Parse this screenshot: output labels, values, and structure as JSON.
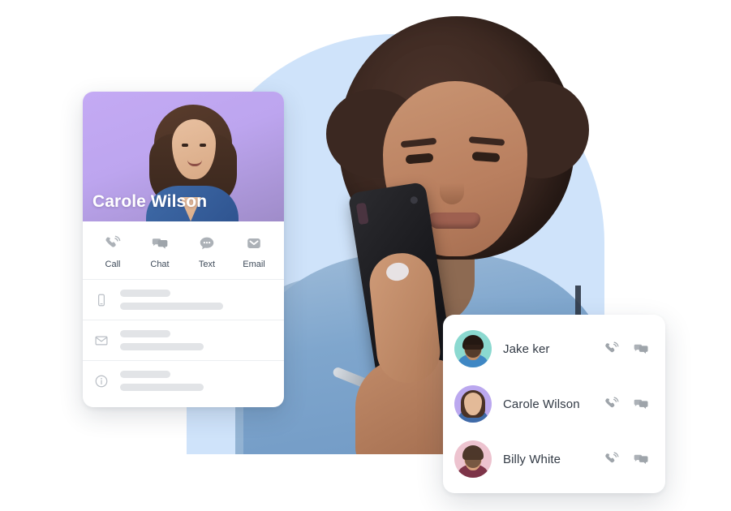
{
  "scene": {
    "backdrop_color": "#cfe3fa",
    "page_background": "#ffffff"
  },
  "hero_photo": {
    "alt": "Nurse in blue scrubs with stethoscope looking at a smartphone",
    "name": "hero-nurse-photo"
  },
  "contact_card": {
    "person_name": "Carole Wilson",
    "header_gradient": [
      "#c4aaf4",
      "#9f8cc9"
    ],
    "actions": [
      {
        "icon": "call-icon",
        "label": "Call"
      },
      {
        "icon": "chat-icon",
        "label": "Chat"
      },
      {
        "icon": "text-icon",
        "label": "Text"
      },
      {
        "icon": "email-icon",
        "label": "Email"
      }
    ],
    "detail_rows": [
      {
        "icon": "mobile-icon",
        "placeholder": true
      },
      {
        "icon": "envelope-icon",
        "placeholder": true
      },
      {
        "icon": "info-icon",
        "placeholder": true
      }
    ]
  },
  "contact_list": {
    "items": [
      {
        "name": "Jake ker",
        "avatar_bg": "#8bd9d0",
        "call_icon": "call-icon",
        "chat_icon": "chat-icon"
      },
      {
        "name": "Carole Wilson",
        "avatar_bg": "#bba8ef",
        "call_icon": "call-icon",
        "chat_icon": "chat-icon"
      },
      {
        "name": "Billy White",
        "avatar_bg": "#edc3cf",
        "call_icon": "call-icon",
        "chat_icon": "chat-icon"
      }
    ]
  }
}
